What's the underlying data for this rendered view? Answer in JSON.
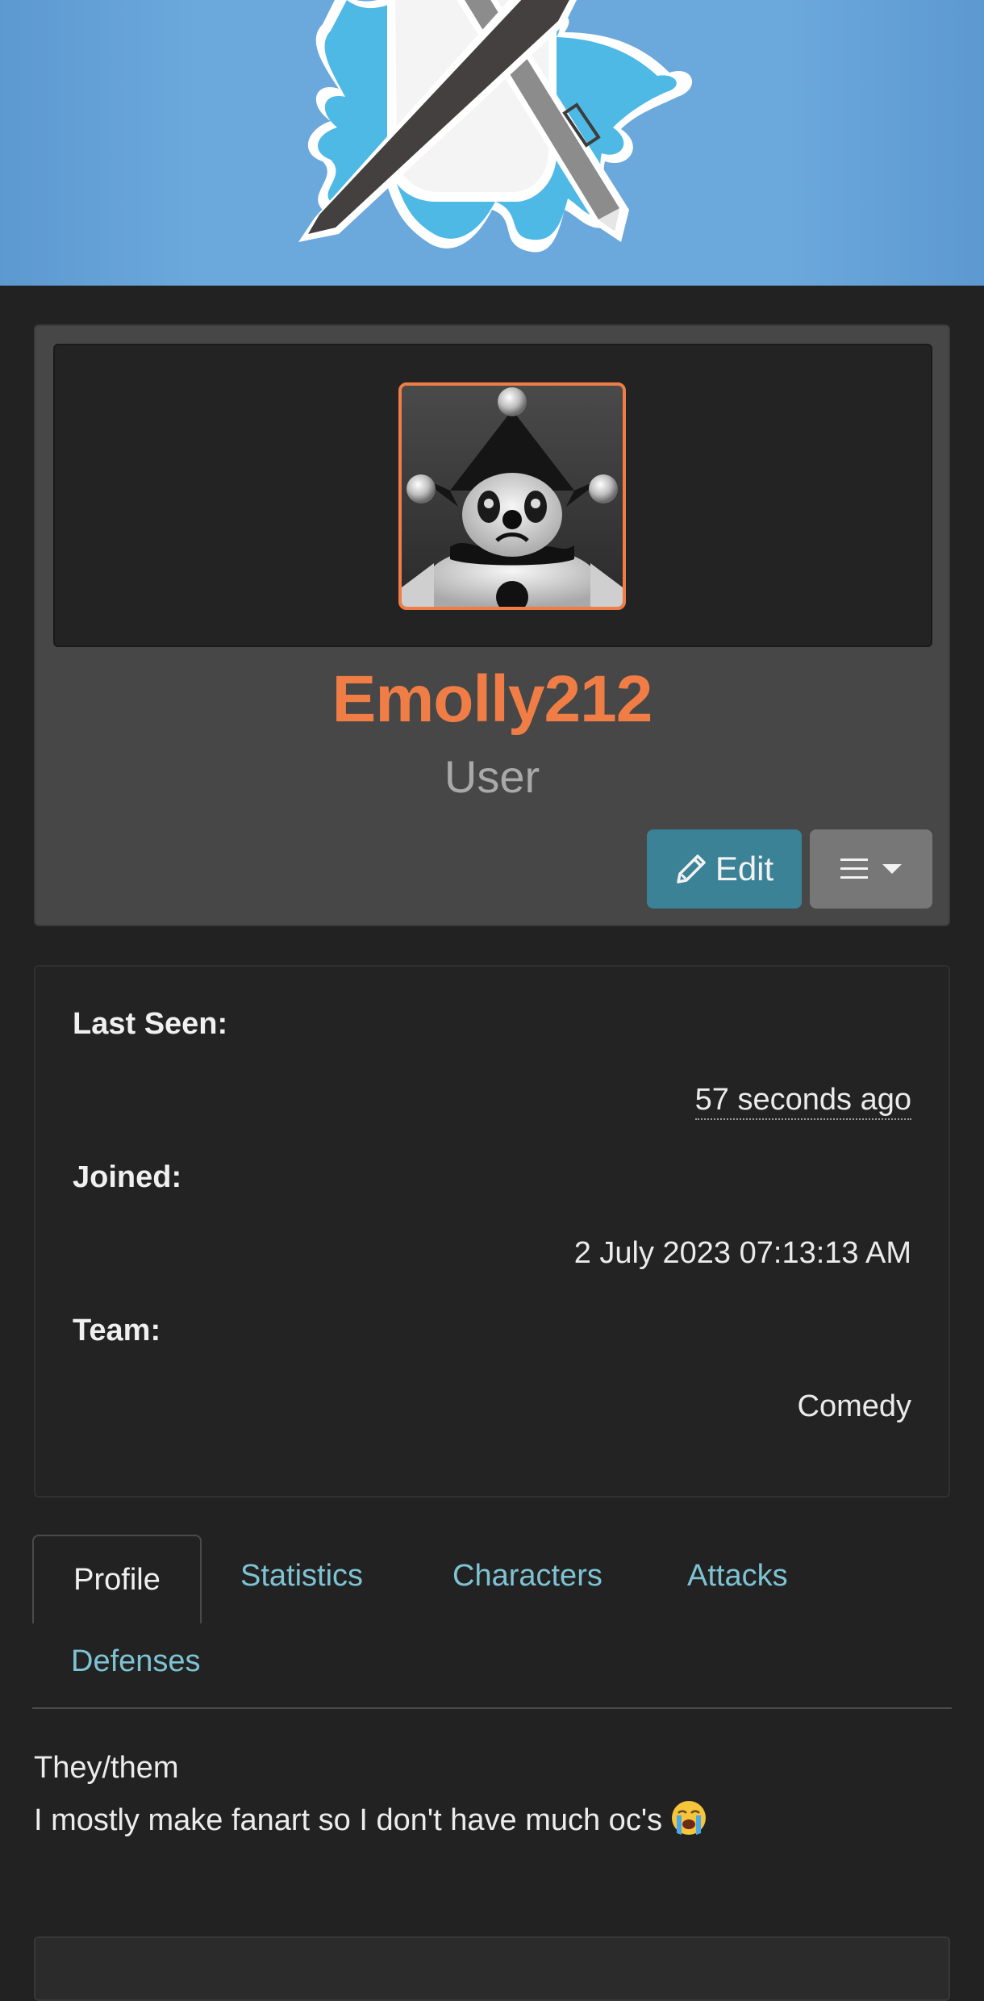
{
  "banner": {
    "logo_icon": "site-logo-knife-pen-splash-icon",
    "colors": {
      "background": "#68a4d9",
      "splash": "#4fb9e6",
      "knife": "#444040",
      "pen": "#8a8a8a"
    }
  },
  "profile": {
    "username": "Emolly212",
    "role": "User",
    "avatar_icon": "clown-avatar-icon",
    "edit_label": "Edit",
    "edit_icon": "pencil-icon",
    "menu_icon": "hamburger-menu-icon",
    "menu_caret_icon": "caret-down-icon",
    "colors": {
      "username": "#f07d45",
      "role": "#a9a9a9",
      "edit_button": "#3b8296",
      "menu_button": "#777777"
    }
  },
  "info": {
    "last_seen_label": "Last Seen:",
    "last_seen_value": "57 seconds ago",
    "joined_label": "Joined:",
    "joined_value": "2 July 2023 07:13:13 AM",
    "team_label": "Team:",
    "team_value": "Comedy"
  },
  "tabs": [
    {
      "label": "Profile",
      "active": true
    },
    {
      "label": "Statistics",
      "active": false
    },
    {
      "label": "Characters",
      "active": false
    },
    {
      "label": "Attacks",
      "active": false
    },
    {
      "label": "Defenses",
      "active": false
    }
  ],
  "bio": {
    "line1": "They/them",
    "line2": "I mostly make fanart so I don't have much oc's",
    "emoji_icon": "loudly-crying-face-emoji-icon"
  }
}
